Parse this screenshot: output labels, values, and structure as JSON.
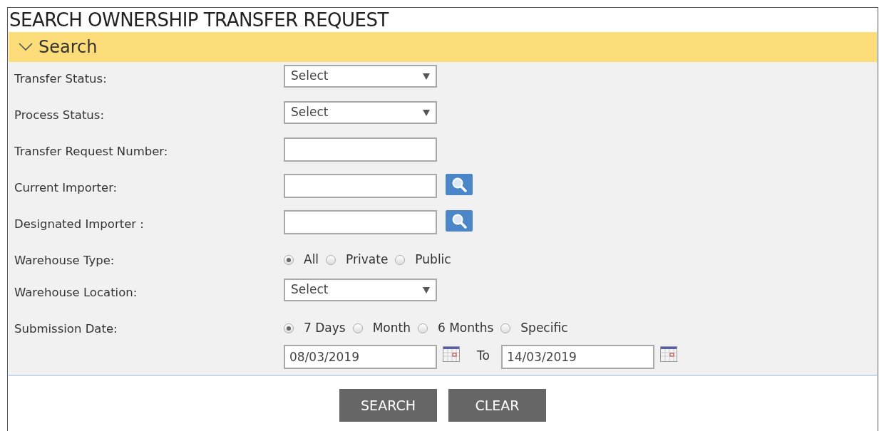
{
  "page_title": "SEARCH OWNERSHIP TRANSFER REQUEST",
  "panel": {
    "title": "Search",
    "expanded": true
  },
  "fields": [
    {
      "kind": "select",
      "label": "Transfer Status:",
      "value": "Select"
    },
    {
      "kind": "select",
      "label": "Process Status:",
      "value": "Select"
    },
    {
      "kind": "text",
      "label": "Transfer Request Number:"
    },
    {
      "kind": "lookup",
      "label": "Current Importer:"
    },
    {
      "kind": "lookup",
      "label": "Designated Importer :"
    },
    {
      "kind": "radio",
      "label": "Warehouse Type:",
      "options": [
        {
          "label": "All",
          "selected": true
        },
        {
          "label": "Private",
          "selected": false
        },
        {
          "label": "Public",
          "selected": false
        }
      ]
    },
    {
      "kind": "select",
      "label": "Warehouse Location:",
      "value": "Select"
    },
    {
      "kind": "radio",
      "label": "Submission Date:",
      "options": [
        {
          "label": "7 Days",
          "selected": true
        },
        {
          "label": "Month",
          "selected": false
        },
        {
          "label": "6 Months",
          "selected": false
        },
        {
          "label": "Specific",
          "selected": false
        }
      ]
    },
    {
      "kind": "daterange",
      "from": "08/03/2019",
      "separator": "To",
      "to": "14/03/2019"
    }
  ],
  "buttons": [
    "SEARCH",
    "CLEAR"
  ]
}
